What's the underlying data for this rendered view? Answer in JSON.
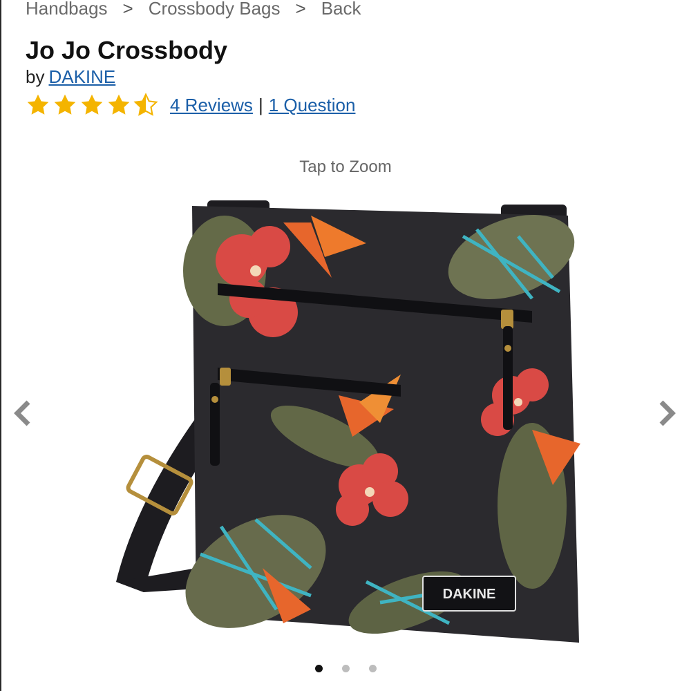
{
  "breadcrumb": {
    "items": [
      "Handbags",
      "Crossbody Bags",
      "Back"
    ],
    "separator": ">"
  },
  "product": {
    "title": "Jo Jo Crossbody",
    "by_prefix": "by",
    "brand": "DAKINE",
    "rating": 4.5,
    "rating_max": 5,
    "reviews_link": "4 Reviews",
    "questions_link": "1 Question",
    "divider": "|"
  },
  "gallery": {
    "zoom_hint": "Tap to Zoom",
    "image_icon": "crossbody-bag-photo",
    "image_label_text": "DAKINE",
    "prev_icon": "chevron-left-icon",
    "next_icon": "chevron-right-icon",
    "total_images": 3,
    "active_index": 0
  },
  "colors": {
    "star": "#f4b400",
    "link": "#1b5fa8",
    "bag_base": "#2b2a2e"
  }
}
